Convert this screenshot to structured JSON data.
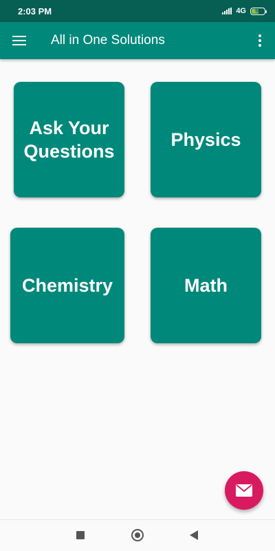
{
  "status_bar": {
    "time": "2:03 PM",
    "network": "4G",
    "battery": "58",
    "battery_level": 0.58,
    "icons": [
      "signal-icon",
      "battery-icon"
    ]
  },
  "app_bar": {
    "title": "All in One Solutions",
    "menu_icon": "hamburger-menu-icon",
    "more_icon": "more-vertical-icon"
  },
  "tiles": [
    {
      "label": "Ask Your Questions"
    },
    {
      "label": "Physics"
    },
    {
      "label": "Chemistry"
    },
    {
      "label": "Math"
    }
  ],
  "fab": {
    "icon": "mail-icon"
  },
  "nav_bar": {
    "icons": [
      "recents-icon",
      "home-icon",
      "back-icon"
    ]
  },
  "colors": {
    "status_bar": "#075e53",
    "primary": "#00887a",
    "accent": "#d81b60",
    "background": "#fafafa"
  }
}
